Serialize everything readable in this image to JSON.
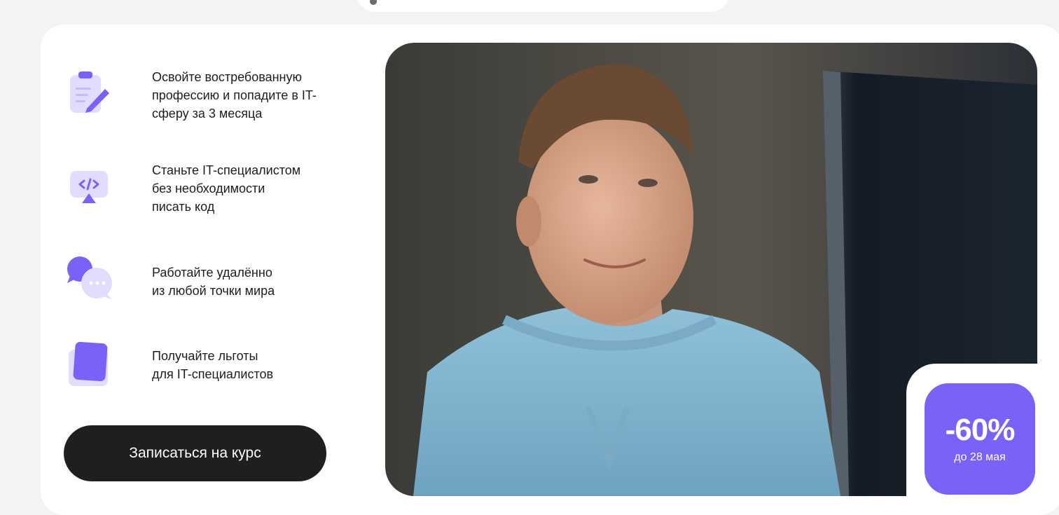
{
  "features": [
    {
      "icon": "clipboard-pencil-icon",
      "text": "Освойте востребованную\nпрофессию и попадите в IT-\nсферу за 3 месяца"
    },
    {
      "icon": "code-monitor-icon",
      "text": "Станьте IT-специалистом\nбез необходимости\nписать код"
    },
    {
      "icon": "chat-bubbles-icon",
      "text": "Работайте удалённо\nиз любой точки мира"
    },
    {
      "icon": "folder-card-icon",
      "text": "Получайте льготы\nдля IT-специалистов"
    }
  ],
  "cta": {
    "label": "Записаться на курс"
  },
  "badge": {
    "discount": "-60%",
    "until": "до 28 мая"
  },
  "colors": {
    "accent": "#7b61f7",
    "cta_bg": "#1f1f22",
    "page_bg": "#f2f3f5",
    "icon_light": "#e3dcff",
    "icon_dark": "#7b61f7"
  }
}
